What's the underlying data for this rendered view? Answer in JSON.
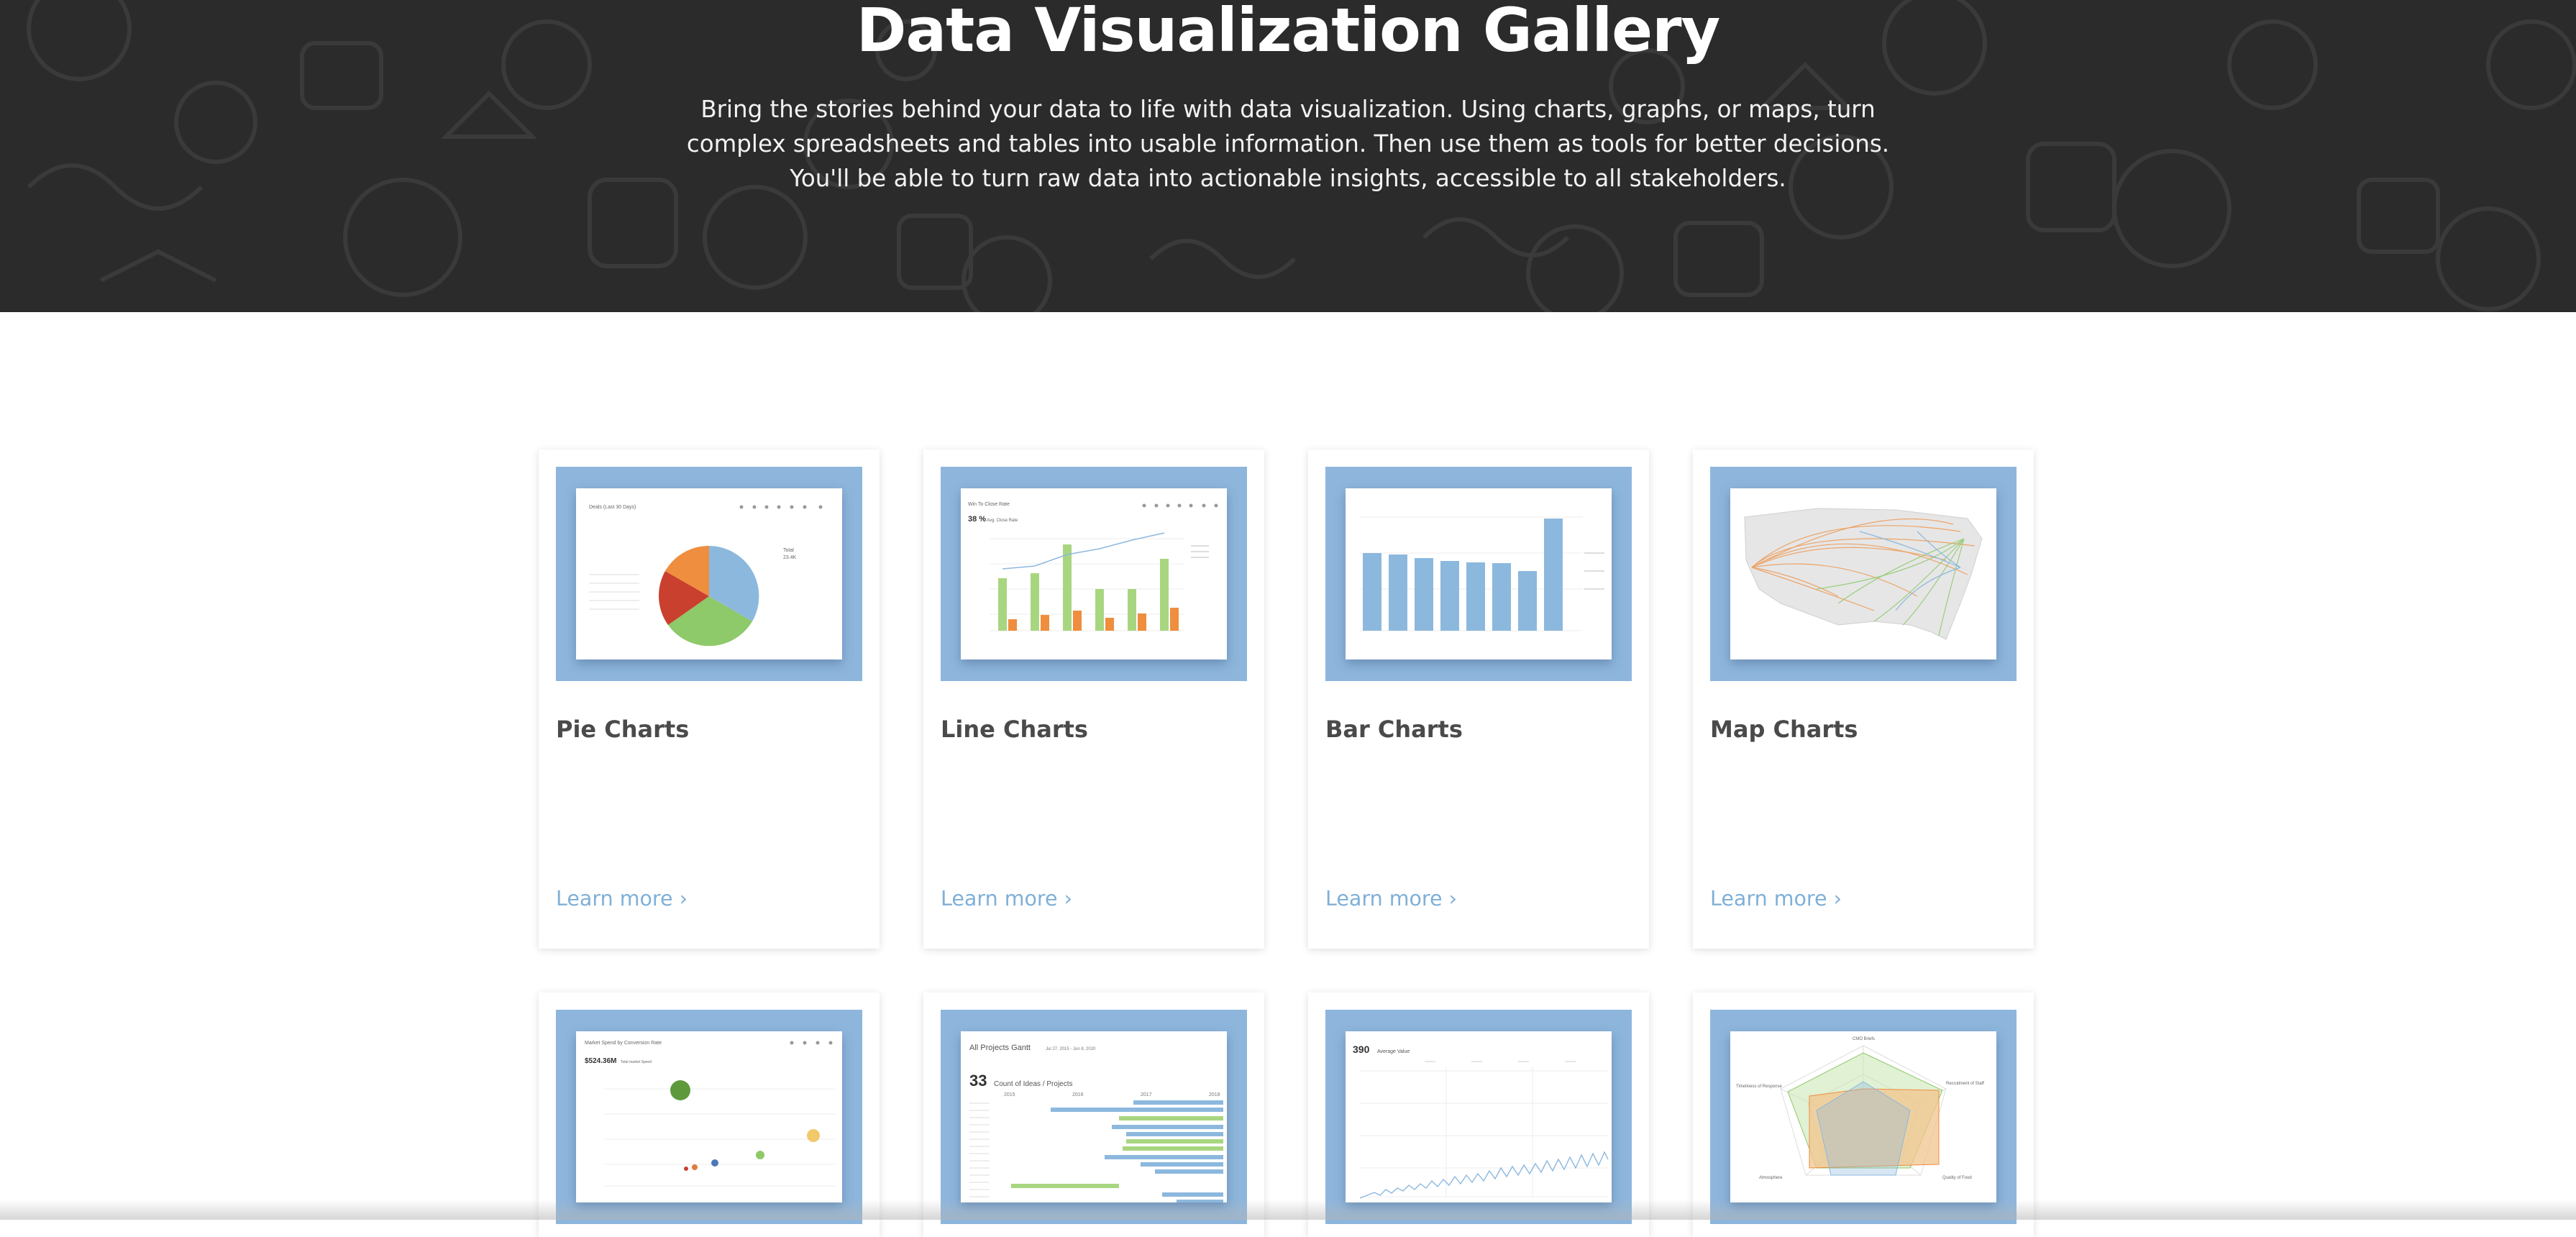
{
  "hero": {
    "title": "Data Visualization Gallery",
    "description": "Bring the stories behind your data to life with data visualization. Using charts, graphs, or maps, turn complex spreadsheets and tables into usable information. Then use them as tools for better decisions. You'll be able to turn raw data into actionable insights, accessible to all stakeholders."
  },
  "colors": {
    "hero_bg": "#2b2b2b",
    "thumb_bg": "#8eb6dc",
    "link": "#7fb0d8",
    "title": "#4a4a4a"
  },
  "cards": [
    {
      "title": "Pie Charts",
      "link": "Learn more ›",
      "thumb": {
        "header": "Deals (Last 30 Days)",
        "total_label": "Total",
        "total_value": "23.4K"
      }
    },
    {
      "title": "Line Charts",
      "link": "Learn more ›",
      "thumb": {
        "header": "Win To Close Rate",
        "kpi": "38 %",
        "kpi_label": "Avg. Close Rate"
      }
    },
    {
      "title": "Bar Charts",
      "link": "Learn more ›"
    },
    {
      "title": "Map Charts",
      "link": "Learn more ›"
    }
  ],
  "cards_row2": [
    {
      "thumb": {
        "header": "Market Spend by Conversion Rate",
        "kpi": "$524.36M",
        "kpi_label": "Total market Spend"
      }
    },
    {
      "thumb": {
        "header": "All Projects Gantt",
        "date_range": "Jul 27, 2015 - Jun 8, 2020",
        "kpi": "33",
        "kpi_label": "Count of Ideas / Projects",
        "years": [
          "2015",
          "2016",
          "2017",
          "2018"
        ]
      }
    },
    {
      "thumb": {
        "kpi": "390",
        "kpi_label": "Average Value"
      }
    },
    {
      "thumb": {
        "axes": [
          "CMO Briefs",
          "Timeliness of Response",
          "Recruitment of Staff",
          "Quality of Food",
          "Atmosphere"
        ]
      }
    }
  ]
}
